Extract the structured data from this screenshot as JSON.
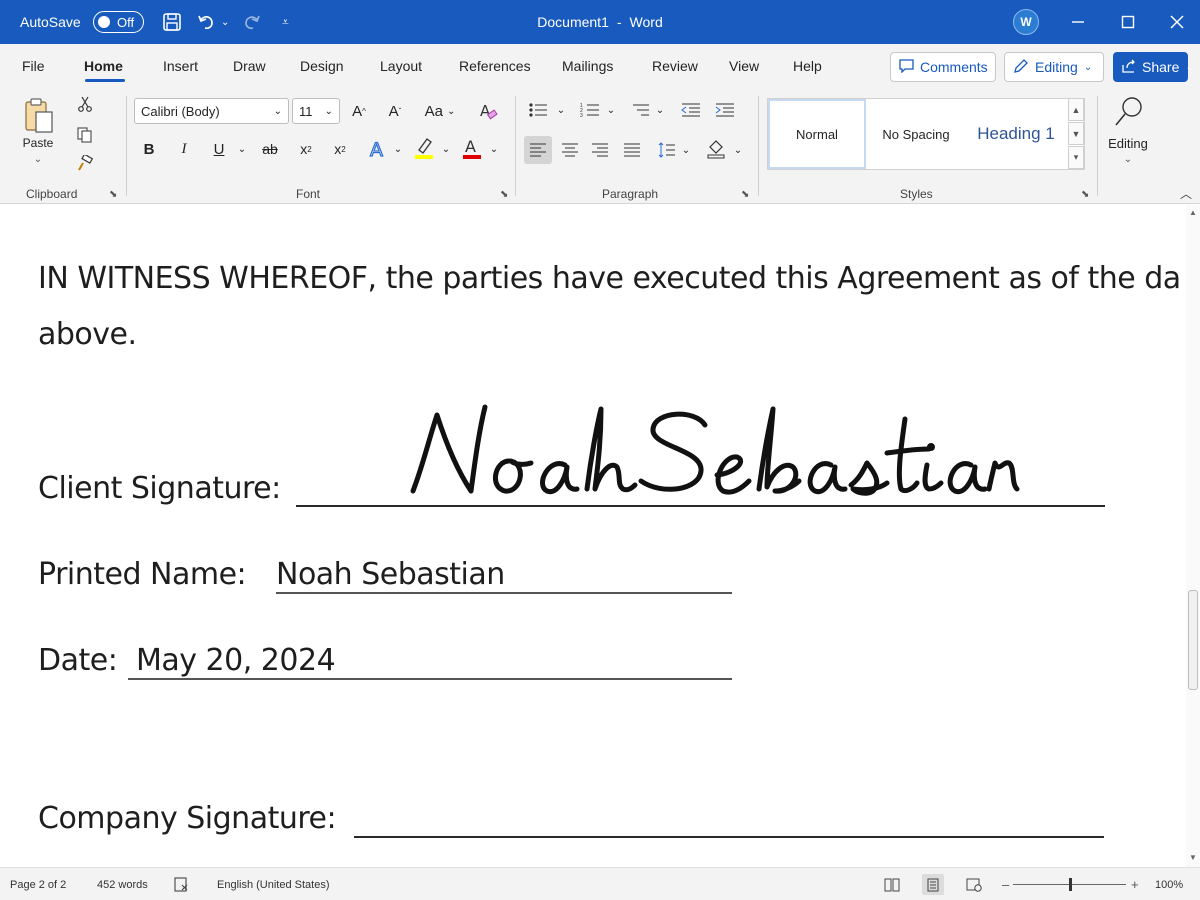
{
  "titlebar": {
    "autosave_label": "AutoSave",
    "autosave_state": "Off",
    "document_name": "Document1",
    "separator": "-",
    "app_name": "Word",
    "avatar_initial": "W"
  },
  "tabs": [
    "File",
    "Home",
    "Insert",
    "Draw",
    "Design",
    "Layout",
    "References",
    "Mailings",
    "Review",
    "View",
    "Help"
  ],
  "active_tab": "Home",
  "header_buttons": {
    "comments": "Comments",
    "editing": "Editing",
    "share": "Share"
  },
  "ribbon": {
    "clipboard": {
      "paste": "Paste",
      "label": "Clipboard"
    },
    "font": {
      "name": "Calibri (Body)",
      "size": "11",
      "label": "Font",
      "case_button": "Aa"
    },
    "paragraph": {
      "label": "Paragraph"
    },
    "styles": {
      "items": [
        "Normal",
        "No Spacing",
        "Heading 1"
      ],
      "label": "Styles"
    },
    "editing": {
      "label": "Editing"
    },
    "accent_color": "#185abd",
    "highlight_color": "#ffff00",
    "font_color": "#e00000"
  },
  "document": {
    "witness_line_1": "IN WITNESS WHEREOF, the parties have executed this Agreement as of the da",
    "witness_line_2": "above.",
    "client_signature_label": "Client Signature:",
    "signature": "Noah Sebastian",
    "printed_name_label": "Printed Name:",
    "printed_name_value": "Noah Sebastian",
    "date_label": "Date:",
    "date_value": "May 20, 2024",
    "company_signature_label": "Company Signature:"
  },
  "statusbar": {
    "page": "Page 2 of 2",
    "words": "452 words",
    "language": "English (United States)",
    "zoom": "100%"
  }
}
